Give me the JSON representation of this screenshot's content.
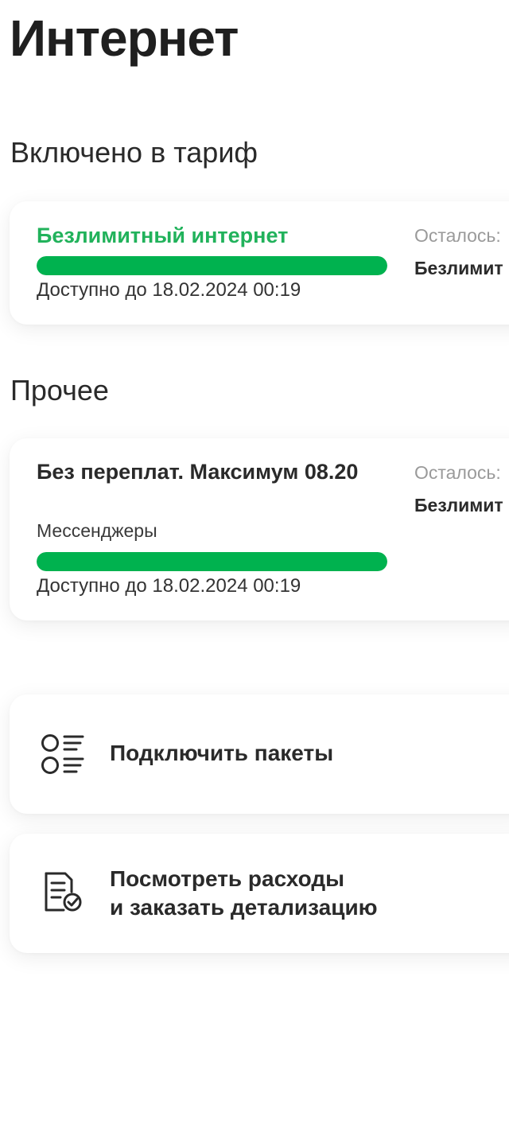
{
  "header": {
    "title": "Интернет"
  },
  "included": {
    "section_title": "Включено в тариф",
    "package": {
      "title": "Безлимитный интернет",
      "progress": 1.0,
      "available_until": "Доступно до 18.02.2024 00:19",
      "remaining_label": "Осталось:",
      "remaining_value": "Безлимит"
    }
  },
  "other": {
    "section_title": "Прочее",
    "package": {
      "title": "Без переплат. Максимум 08.20",
      "subtitle": "Мессенджеры",
      "progress": 1.0,
      "available_until": "Доступно до 18.02.2024 00:19",
      "remaining_label": "Осталось:",
      "remaining_value": "Безлимит"
    }
  },
  "actions": {
    "connect_packages": {
      "label": "Подключить пакеты",
      "icon": "list-options-icon"
    },
    "view_expenses": {
      "label_line1": "Посмотреть расходы",
      "label_line2": "и заказать детализацию",
      "icon": "document-check-icon"
    }
  },
  "colors": {
    "accent_green": "#00b24f",
    "title_green": "#21b25b",
    "text_dark": "#2a2a2a",
    "text_muted": "#9a9a9a"
  }
}
